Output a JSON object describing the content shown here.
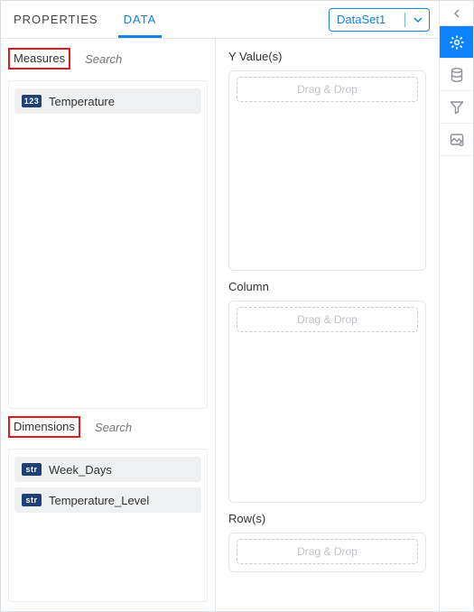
{
  "tabs": {
    "properties": "PROPERTIES",
    "data": "DATA"
  },
  "dataset": {
    "selected": "DataSet1"
  },
  "measures": {
    "label": "Measures",
    "search_placeholder": "Search",
    "items": [
      {
        "badge": "123",
        "name": "Temperature"
      }
    ]
  },
  "dimensions": {
    "label": "Dimensions",
    "search_placeholder": "Search",
    "items": [
      {
        "badge": "str",
        "name": "Week_Days"
      },
      {
        "badge": "str",
        "name": "Temperature_Level"
      }
    ]
  },
  "drop": {
    "y_label": "Y Value(s)",
    "col_label": "Column",
    "row_label": "Row(s)",
    "placeholder": "Drag & Drop"
  }
}
